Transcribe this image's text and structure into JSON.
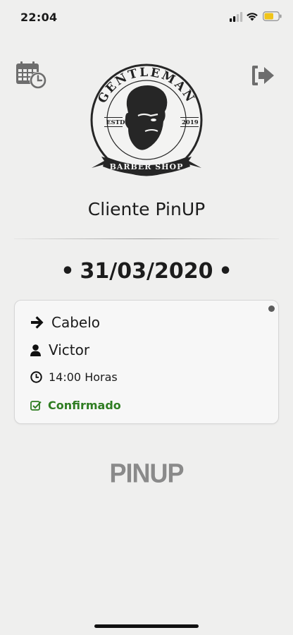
{
  "status_bar": {
    "time": "22:04"
  },
  "logo": {
    "top_text": "GENTLEMAN",
    "estd_label": "ESTD",
    "year": "2019",
    "banner_text": "BARBER SHOP"
  },
  "header": {
    "client_name": "Cliente PinUP",
    "calendar_icon": "calendar-clock-icon",
    "logout_icon": "sign-out-icon"
  },
  "date": {
    "value": "31/03/2020",
    "separator": "•"
  },
  "appointment": {
    "service": "Cabelo",
    "barber": "Victor",
    "time": "14:00 Horas",
    "status": "Confirmado",
    "status_color": "#2f7d22"
  },
  "brand": {
    "name": "PINUP"
  },
  "colors": {
    "background": "#efefee",
    "card": "#f7f7f7",
    "text": "#1c1c1c",
    "icon_gray": "#6d6d6d"
  }
}
